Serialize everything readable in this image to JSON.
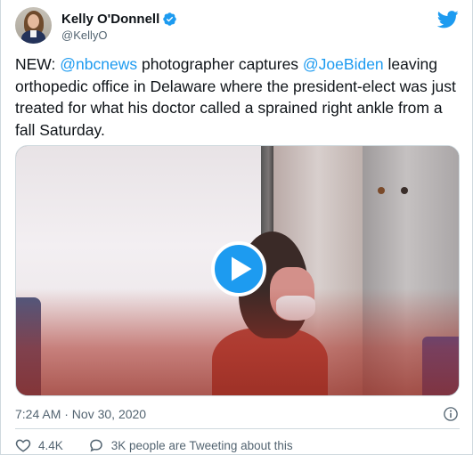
{
  "author": {
    "display_name": "Kelly O'Donnell",
    "handle": "@KellyO"
  },
  "icons": {
    "verified": "verified-badge-icon",
    "brand": "twitter-bird-icon",
    "play": "play-icon",
    "info": "info-icon",
    "like": "heart-icon",
    "reply": "comment-bubble-icon"
  },
  "tweet": {
    "text_prefix": "NEW:  ",
    "mention_1": "@nbcnews",
    "text_middle": " photographer captures ",
    "mention_2": "@JoeBiden",
    "text_suffix": " leaving orthopedic office in Delaware where the president-elect was just treated for what his doctor called a sprained right ankle from a fall Saturday."
  },
  "meta": {
    "timestamp": "7:24 AM · Nov 30, 2020"
  },
  "actions": {
    "likes": "4.4K",
    "tweeting_about": "3K people are Tweeting about this"
  },
  "colors": {
    "accent": "#1d9bf0",
    "text": "#0f1419",
    "secondary": "#536471",
    "border": "#cfd9de"
  }
}
